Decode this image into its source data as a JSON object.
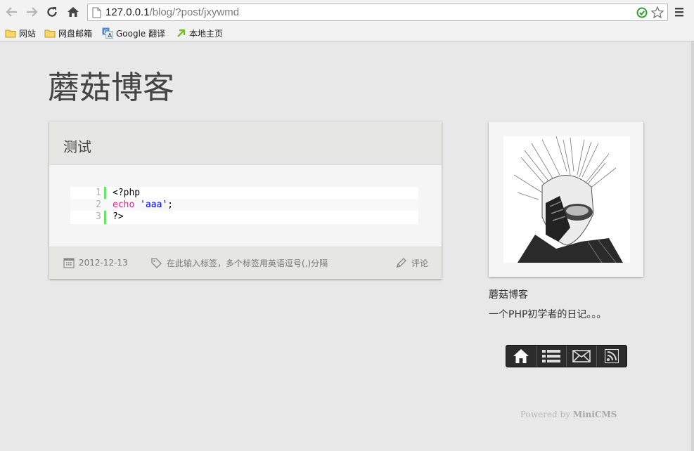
{
  "browser": {
    "url_host": "127.0.0.1",
    "url_path": "/blog/?post/jxywmd",
    "bookmarks": [
      {
        "label": "网站",
        "icon": "folder-icon"
      },
      {
        "label": "网盘邮箱",
        "icon": "folder-icon"
      },
      {
        "label": "Google 翻译",
        "icon": "translate-icon"
      },
      {
        "label": "本地主页",
        "icon": "arrow-icon"
      }
    ]
  },
  "site": {
    "title": "蘑菇博客"
  },
  "post": {
    "title": "测试",
    "code": {
      "line_numbers": [
        "1",
        "2",
        "3"
      ],
      "line1": "<?php",
      "line2_kw": "echo",
      "line2_str": "'aaa'",
      "line2_end": ";",
      "line3": "?>"
    },
    "date": "2012-12-13",
    "tags_placeholder": "在此输入标签，多个标签用英语逗号(,)分隔",
    "comment_label": "评论"
  },
  "sidebar": {
    "name": "蘑菇博客",
    "description": "一个PHP初学者的日记。。。",
    "icons": [
      "home-icon",
      "list-icon",
      "mail-icon",
      "rss-icon"
    ]
  },
  "footer": {
    "powered_prefix": "Powered by",
    "powered_name": "MiniCMS"
  },
  "colors": {
    "code_gutter_border": "#6ce26c",
    "code_keyword": "#ff1493",
    "code_string": "#0000ff"
  }
}
